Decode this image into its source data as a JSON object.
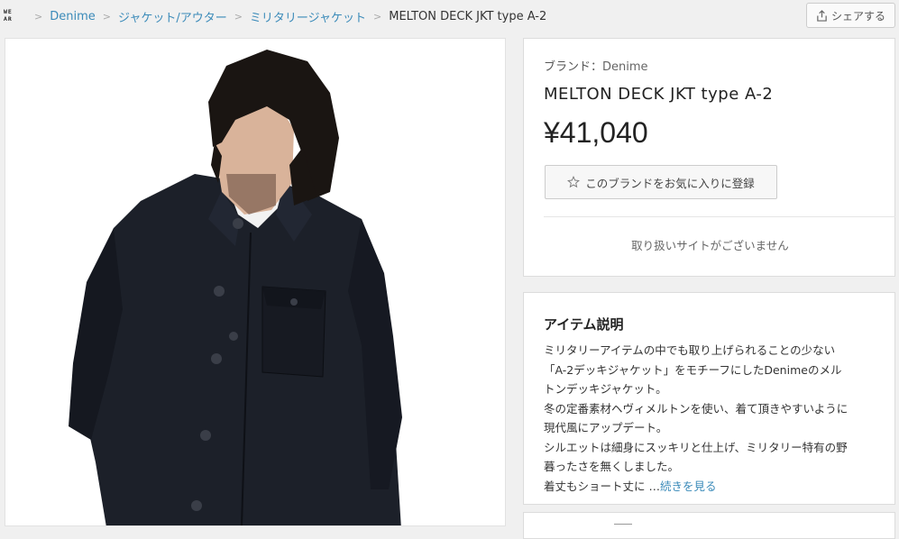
{
  "logo": {
    "line1": "WE",
    "line2": "AR"
  },
  "breadcrumb": {
    "items": [
      {
        "label": "Denime"
      },
      {
        "label": "ジャケット/アウター"
      },
      {
        "label": "ミリタリージャケット"
      }
    ],
    "current": "MELTON DECK JKT type A-2"
  },
  "share": {
    "label": "シェアする",
    "icon": "share-icon"
  },
  "product": {
    "brand_prefix": "ブランド：",
    "brand": "Denime",
    "name": "MELTON DECK JKT type A-2",
    "price": "¥41,040",
    "favorite_label": "このブランドをお気に入りに登録",
    "favorite_icon": "star-outline-icon",
    "no_site_text": "取り扱いサイトがございません"
  },
  "description": {
    "title": "アイテム説明",
    "lines": [
      "ミリタリーアイテムの中でも取り上げられることの少ない",
      "「A-2デッキジャケット」をモチーフにしたDenimeのメル",
      "トンデッキジャケット。",
      "冬の定番素材ヘヴィメルトンを使い、着て頂きやすいように",
      "現代風にアップデート。",
      "シルエットは細身にスッキリと仕上げ、ミリタリー特有の野",
      "暮ったさを無くしました。"
    ],
    "last_line": "着丈もショート丈に …",
    "more_label": "続きを見る"
  },
  "colors": {
    "link": "#3a8ab9",
    "jacket": "#1c2029",
    "background": "#f0f0f0"
  }
}
